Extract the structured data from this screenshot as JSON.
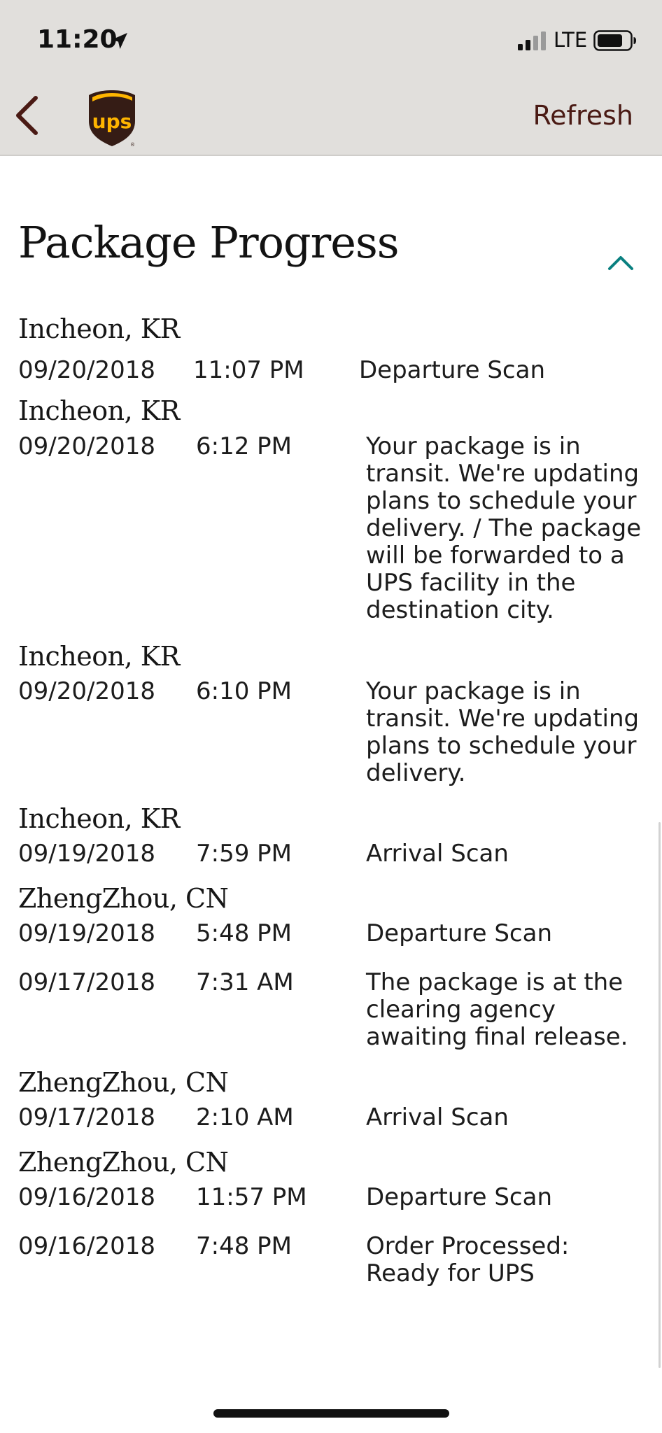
{
  "status_bar": {
    "time": "11:20",
    "network": "LTE"
  },
  "nav": {
    "back_icon": "chevron-left-icon",
    "logo": "ups",
    "refresh_label": "Refresh"
  },
  "section": {
    "title": "Package Progress",
    "toggle_icon": "chevron-up-icon"
  },
  "events": [
    {
      "location": "Incheon, KR",
      "date": "09/20/2018",
      "time": "11:07 PM",
      "description": "Departure Scan"
    },
    {
      "location": "Incheon, KR",
      "date": "09/20/2018",
      "time": "6:12 PM",
      "description": "Your package is in\ntransit. We're updating\nplans to schedule your\ndelivery. / The package\nwill be forwarded to a\nUPS facility in the\ndestination city."
    },
    {
      "location": "Incheon, KR",
      "date": "09/20/2018",
      "time": "6:10 PM",
      "description": "Your package is in\ntransit. We're updating\nplans to schedule your\ndelivery."
    },
    {
      "location": "Incheon, KR",
      "date": "09/19/2018",
      "time": "7:59 PM",
      "description": "Arrival Scan"
    },
    {
      "location": "ZhengZhou, CN",
      "date": "09/19/2018",
      "time": "5:48 PM",
      "description": "Departure Scan"
    },
    {
      "location": "",
      "date": "09/17/2018",
      "time": "7:31 AM",
      "description": "The package is at the\nclearing agency\nawaiting final release."
    },
    {
      "location": "ZhengZhou, CN",
      "date": "09/17/2018",
      "time": "2:10 AM",
      "description": "Arrival Scan"
    },
    {
      "location": "ZhengZhou, CN",
      "date": "09/16/2018",
      "time": "11:57 PM",
      "description": "Departure Scan"
    },
    {
      "location": "",
      "date": "09/16/2018",
      "time": "7:48 PM",
      "description": "Order Processed:\nReady for UPS"
    }
  ],
  "colors": {
    "header_bg": "#e1dfdc",
    "accent_brown": "#4a1a14",
    "ups_brown": "#351c15",
    "ups_gold": "#ffb500",
    "toggle_teal": "#0a8080"
  }
}
